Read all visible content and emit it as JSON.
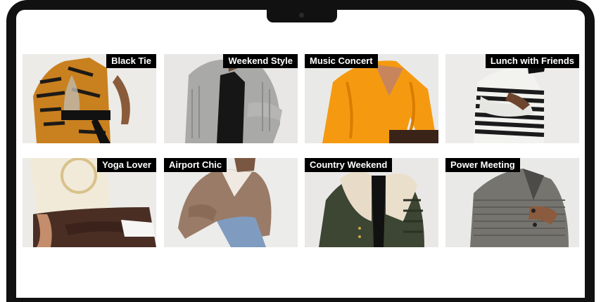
{
  "categories": [
    {
      "label": "Black Tie",
      "align": "right"
    },
    {
      "label": "Weekend Style",
      "align": "right"
    },
    {
      "label": "Music Concert",
      "align": "left"
    },
    {
      "label": "Lunch with Friends",
      "align": "right"
    },
    {
      "label": "Yoga Lover",
      "align": "right"
    },
    {
      "label": "Airport Chic",
      "align": "left"
    },
    {
      "label": "Country Weekend",
      "align": "left"
    },
    {
      "label": "Power Meeting",
      "align": "left"
    }
  ]
}
